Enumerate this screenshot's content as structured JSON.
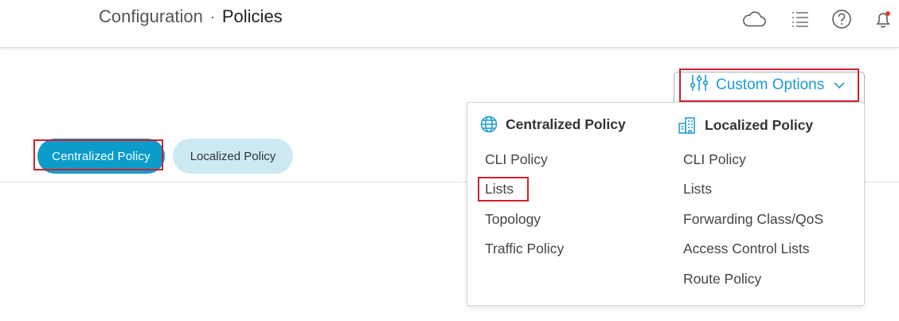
{
  "header": {
    "breadcrumb_parent": "Configuration",
    "separator": "·",
    "breadcrumb_current": "Policies",
    "icons": [
      "cloud-icon",
      "list-icon",
      "help-icon",
      "bell-icon"
    ],
    "notification_dot_color": "#e0452b"
  },
  "custom_options": {
    "label": "Custom Options",
    "accent": "#1c9bd1"
  },
  "tabs": [
    {
      "label": "Centralized Policy",
      "active": true
    },
    {
      "label": "Localized Policy",
      "active": false
    }
  ],
  "dropdown": {
    "centralized": {
      "heading": "Centralized Policy",
      "items": [
        "CLI Policy",
        "Lists",
        "Topology",
        "Traffic Policy"
      ]
    },
    "localized": {
      "heading": "Localized Policy",
      "items": [
        "CLI Policy",
        "Lists",
        "Forwarding Class/QoS",
        "Access Control Lists",
        "Route Policy"
      ]
    }
  },
  "highlight_color": "#d0202e"
}
